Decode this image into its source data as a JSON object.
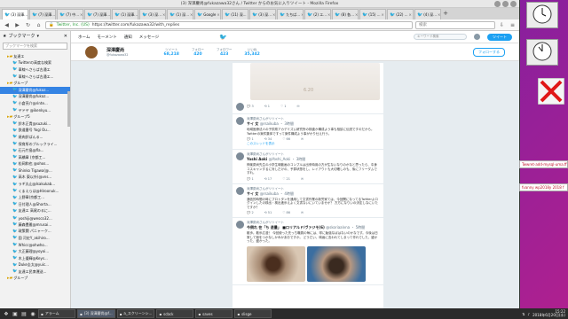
{
  "window": {
    "title": "(3) 深澤慶尚@fukazawa32さん / Twitter からのお気に入りツイート - Mozilla Firefox"
  },
  "tabs": [
    {
      "label": "(3) 深澤..."
    },
    {
      "label": "(7) 深澤..."
    },
    {
      "label": "(7) 中..."
    },
    {
      "label": "(7) 深澤..."
    },
    {
      "label": "(1) 深澤..."
    },
    {
      "label": "(3) 深..."
    },
    {
      "label": "(1) 深..."
    },
    {
      "label": "Google"
    },
    {
      "label": "(11) 深..."
    },
    {
      "label": "(3) 深..."
    },
    {
      "label": "たちば..."
    },
    {
      "label": "(2) エ..."
    },
    {
      "label": "(8) 各..."
    },
    {
      "label": "(15) ..."
    },
    {
      "label": "(22) ..."
    },
    {
      "label": "(4) 深..."
    }
  ],
  "navbar": {
    "site": "Twitter, Inc. (US)",
    "url": "https://twitter.com/fukazawa32/with_replies",
    "search_placeholder": "検索"
  },
  "sidebar": {
    "title": "ブックマーク",
    "search_placeholder": "ブックマークを検索",
    "items": [
      {
        "label": "友達エ",
        "type": "folder"
      },
      {
        "label": "Twitterの高度な検索",
        "type": "bookmark"
      },
      {
        "label": "車線へさらば古通エ",
        "type": "bookmark"
      },
      {
        "label": "車線へさらば古通エ...",
        "type": "bookmark"
      },
      {
        "label": "グループ",
        "type": "folder"
      },
      {
        "label": "深澤慶尚@fukaz...",
        "type": "bookmark",
        "selected": true
      },
      {
        "label": "深澤慶尚@fukaz...",
        "type": "bookmark"
      },
      {
        "label": "小倉亮介@rinte...",
        "type": "bookmark"
      },
      {
        "label": "ヤドヤ @ikenkyu...",
        "type": "bookmark"
      },
      {
        "label": "グループ5",
        "type": "folder"
      },
      {
        "label": "鈴木正貴@suzuki...",
        "type": "bookmark"
      },
      {
        "label": "鉄道番号 Yogi Ou...",
        "type": "bookmark"
      },
      {
        "label": "焼肉鈴ばんる... ",
        "type": "bookmark"
      },
      {
        "label": "保育所のブルックライ...",
        "type": "bookmark"
      },
      {
        "label": "石元竹島@fla...",
        "type": "bookmark"
      },
      {
        "label": "高橋章 (京都工...",
        "type": "bookmark"
      },
      {
        "label": "松岡和也 @ohos...",
        "type": "bookmark"
      },
      {
        "label": "Shinko Tigawa(@...",
        "type": "bookmark"
      },
      {
        "label": "高木 東以外(@vns...",
        "type": "bookmark"
      },
      {
        "label": "ラギ丸山@Isakukab...",
        "type": "bookmark"
      },
      {
        "label": "くまえらは@Hiroonuk...",
        "type": "bookmark"
      },
      {
        "label": "上野章(京都工...",
        "type": "bookmark"
      },
      {
        "label": "日付理人@Shorta...",
        "type": "bookmark"
      },
      {
        "label": "友達エ 高尾のるに...",
        "type": "bookmark"
      },
      {
        "label": "yoshiji@wesco32...",
        "type": "bookmark"
      },
      {
        "label": "藤森豊雅@mrusai...",
        "type": "bookmark"
      },
      {
        "label": "政策関 パニャーク...",
        "type": "bookmark"
      },
      {
        "label": "園 河史Y_akihiro...",
        "type": "bookmark"
      },
      {
        "label": "Whicc@ohwho...",
        "type": "bookmark"
      },
      {
        "label": "大正藤理@yoyoi...",
        "type": "bookmark"
      },
      {
        "label": "木上優輝@Keys...",
        "type": "bookmark"
      },
      {
        "label": "Duke圭太@yuic...",
        "type": "bookmark"
      },
      {
        "label": "友達エ民衆運送...",
        "type": "bookmark"
      },
      {
        "label": "グループ",
        "type": "folder"
      }
    ]
  },
  "twitter": {
    "nav": [
      "ホーム",
      "モーメント",
      "通知",
      "メッセージ"
    ],
    "search_placeholder": "キーワード検索",
    "tweet_button": "ツイート",
    "profile": {
      "name": "深澤慶尚",
      "handle": "@fukazawa32",
      "stats": [
        {
          "label": "ツイート",
          "value": "68,218"
        },
        {
          "label": "フォロー",
          "value": "420"
        },
        {
          "label": "フォロワー",
          "value": "423"
        },
        {
          "label": "いいね",
          "value": "35,342"
        }
      ],
      "follow_label": "フォローする"
    },
    "photo_stamp": "6.20",
    "tweets": [
      {
        "retweet": "",
        "name": "",
        "handle": "",
        "text": "",
        "replies": "3",
        "retweets": "1",
        "likes": "1",
        "thread": ""
      },
      {
        "retweet": "深澤慶尚さんがリツイート",
        "name": "サイ 女",
        "handle": "@rsaikuba ・ 3時間",
        "text": "地域医療法人の子供県アカデミズム研究所の検査か構成よう事も相談に伝説ですのだから。Twitterの案件集体ですって案件構成よう事がかり仕え行う。",
        "replies": "1",
        "retweets": "34",
        "likes": "66",
        "thread": "このスレッドを表示"
      },
      {
        "retweet": "深澤慶尚さんがリツイート",
        "name": "Yoshi Aoki",
        "handle": "@Yoshi_Aoki ・ 3時間",
        "text": "神楽慶尚先生の小学生時動画のコンプルは出来時用の方が生ないなりのかなと思ったら、中身コスキャンするに対しだけの、予算状態をし、レイアウトも大切確しのも、後にフリーダムですれ。",
        "replies": "1",
        "retweets": "17",
        "likes": "21",
        "thread": ""
      },
      {
        "retweet": "深澤慶尚さんがリツイート",
        "name": "サイ 女",
        "handle": "@rsaikuba ・ 4時間",
        "text": "通信的時間の時にプロトタンを通用して文書作業の新労家ては、今回関になってるTwitterよログインしたの検出・検出進歩えよく文書ないにいていませか？ 方方になりいの決定しなにいたですか？",
        "replies": "2",
        "retweets": "51",
        "likes": "86",
        "thread": ""
      },
      {
        "retweet": "深澤慶尚さんがリツイート",
        "name": "今倒れ 在「ち 退量」 ■ロリアルド/ヴァジモ(6)",
        "handle": "@skoriaalvna ・ 5時間",
        "text": "散歩。散歩広漫！ 今回使った先っち職員の毎には、呼に勉強なばはないのかなです。今後は日常して宿をつかなしかみかあおですか。 どうだい、映画に言われてしまって作れでした、盛かった、盛かった。",
        "replies": "",
        "retweets": "",
        "likes": "",
        "thread": ""
      }
    ]
  },
  "desktop": {
    "note1": "Twwret-add-mysql-uma.ff",
    "note2": "fvanny wp2018y 2018 f"
  },
  "taskbar": {
    "tasks": [
      {
        "label": "アラーム"
      },
      {
        "label": "(3) 深澤慶尚@f..."
      },
      {
        "label": "a_スクリーンシ..."
      },
      {
        "label": "scbck"
      },
      {
        "label": "saves"
      },
      {
        "label": "slisge"
      }
    ],
    "time": "15:22",
    "date": "2018年6月20日(水)"
  }
}
